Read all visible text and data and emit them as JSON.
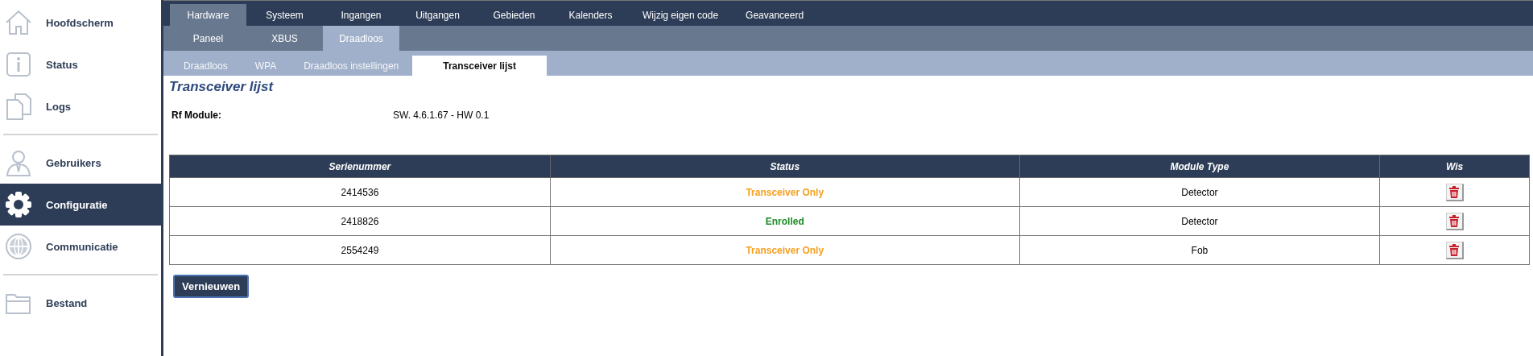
{
  "sidebar": {
    "items": [
      {
        "label": "Hoofdscherm",
        "selected": false
      },
      {
        "label": "Status",
        "selected": false
      },
      {
        "label": "Logs",
        "selected": false
      },
      {
        "label": "Gebruikers",
        "selected": false,
        "divider_before": true
      },
      {
        "label": "Configuratie",
        "selected": true
      },
      {
        "label": "Communicatie",
        "selected": false
      },
      {
        "label": "Bestand",
        "selected": false,
        "divider_before": true
      }
    ]
  },
  "tabs": [
    {
      "label": "Hardware",
      "selected": true
    },
    {
      "label": "Systeem",
      "selected": false
    },
    {
      "label": "Ingangen",
      "selected": false
    },
    {
      "label": "Uitgangen",
      "selected": false
    },
    {
      "label": "Gebieden",
      "selected": false
    },
    {
      "label": "Kalenders",
      "selected": false
    },
    {
      "label": "Wijzig eigen code",
      "selected": false
    },
    {
      "label": "Geavanceerd",
      "selected": false
    }
  ],
  "subtabs": [
    {
      "label": "Paneel",
      "selected": false
    },
    {
      "label": "XBUS",
      "selected": false
    },
    {
      "label": "Draadloos",
      "selected": true
    }
  ],
  "subsubtabs": [
    {
      "label": "Draadloos",
      "selected": false
    },
    {
      "label": "WPA",
      "selected": false
    },
    {
      "label": "Draadloos instellingen",
      "selected": false
    },
    {
      "label": "Transceiver lijst",
      "selected": true
    }
  ],
  "page_title": "Transceiver lijst",
  "rf_module": {
    "label": "Rf Module:",
    "value": "SW. 4.6.1.67 - HW 0.1"
  },
  "table": {
    "columns": [
      "Serienummer",
      "Status",
      "Module Type",
      "Wis"
    ],
    "rows": [
      {
        "serial": "2414536",
        "status": "Transceiver Only",
        "color": "#f5a01e",
        "module_type": "Detector"
      },
      {
        "serial": "2418826",
        "status": "Enrolled",
        "color": "#1a8a24",
        "module_type": "Detector"
      },
      {
        "serial": "2554249",
        "status": "Transceiver Only",
        "color": "#f5a01e",
        "module_type": "Fob"
      }
    ]
  },
  "refresh_button": "Vernieuwen"
}
